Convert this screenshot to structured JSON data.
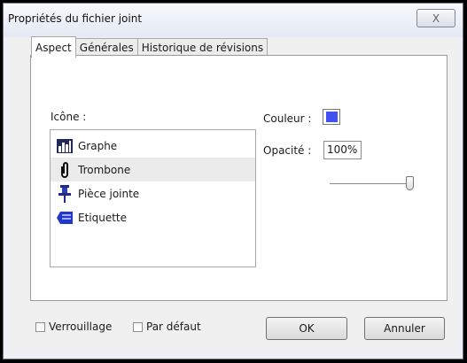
{
  "window": {
    "title": "Propriétés du fichier joint",
    "close_label": "X"
  },
  "tabs": [
    {
      "label": "Aspect",
      "active": true
    },
    {
      "label": "Générales",
      "active": false
    },
    {
      "label": "Historique de révisions",
      "active": false
    }
  ],
  "aspect": {
    "icon_label": "Icône :",
    "icons": [
      {
        "label": "Graphe",
        "icon": "bar-chart-icon",
        "selected": false
      },
      {
        "label": "Trombone",
        "icon": "paperclip-icon",
        "selected": true
      },
      {
        "label": "Pièce jointe",
        "icon": "pushpin-icon",
        "selected": false
      },
      {
        "label": "Etiquette",
        "icon": "tag-icon",
        "selected": false
      }
    ],
    "color_label": "Couleur :",
    "color_value": "#3f51f0",
    "opacity_label": "Opacité :",
    "opacity_value": "100%",
    "opacity_fraction": 1.0
  },
  "footer": {
    "lock_label": "Verrouillage",
    "lock_checked": false,
    "default_label": "Par défaut",
    "default_checked": false,
    "ok_label": "OK",
    "cancel_label": "Annuler"
  }
}
